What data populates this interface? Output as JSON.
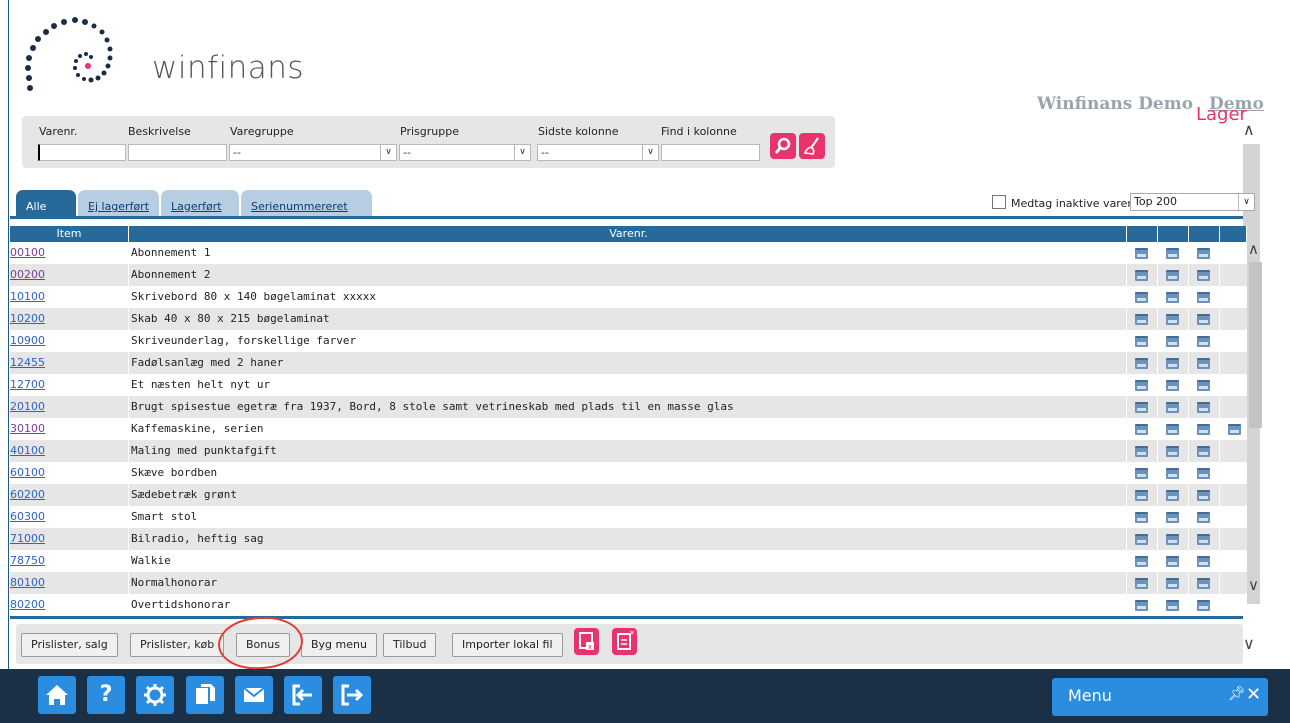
{
  "header": {
    "brand": "winfinans",
    "company": "Winfinans Demo",
    "company_link": "Demo",
    "page_title": "Lager"
  },
  "filters": {
    "labels": [
      "Varenr.",
      "Beskrivelse",
      "Varegruppe",
      "Prisgruppe",
      "Sidste kolonne",
      "Find i kolonne"
    ],
    "varegruppe_value": "--",
    "prisgruppe_value": "--",
    "sidste_kolonne_value": "--"
  },
  "tabs": [
    "Alle",
    "Ej lagerført",
    "Lagerført",
    "Serienummereret"
  ],
  "active_tab": 0,
  "options": {
    "inactive_label": "Medtag inaktive varer",
    "top_select": "Top 200"
  },
  "table": {
    "columns": [
      "Item",
      "Varenr."
    ],
    "rows": [
      {
        "item": "00100",
        "desc": "Abonnement 1",
        "visited": true,
        "docs": 3
      },
      {
        "item": "00200",
        "desc": "Abonnement 2",
        "visited": true,
        "docs": 3
      },
      {
        "item": "10100",
        "desc": "Skrivebord 80 x 140 bøgelaminat xxxxx",
        "visited": false,
        "docs": 3
      },
      {
        "item": "10200",
        "desc": "Skab 40 x 80 x 215 bøgelaminat",
        "visited": false,
        "docs": 3
      },
      {
        "item": "10900",
        "desc": "Skriveunderlag, forskellige farver",
        "visited": false,
        "docs": 3
      },
      {
        "item": "12455",
        "desc": "Fadølsanlæg med 2 haner",
        "visited": false,
        "docs": 3
      },
      {
        "item": "12700",
        "desc": "Et næsten helt nyt ur",
        "visited": false,
        "docs": 3
      },
      {
        "item": "20100",
        "desc": "Brugt spisestue egetræ fra 1937, Bord, 8 stole samt vetrineskab med plads til en masse glas",
        "visited": false,
        "docs": 3
      },
      {
        "item": "30100",
        "desc": "Kaffemaskine, serien",
        "visited": true,
        "docs": 4
      },
      {
        "item": "40100",
        "desc": "Maling med punktafgift",
        "visited": false,
        "docs": 3
      },
      {
        "item": "60100",
        "desc": "Skæve bordben",
        "visited": false,
        "docs": 3
      },
      {
        "item": "60200",
        "desc": "Sædebetræk grønt",
        "visited": false,
        "docs": 3
      },
      {
        "item": "60300",
        "desc": "Smart stol",
        "visited": false,
        "docs": 3
      },
      {
        "item": "71000",
        "desc": "Bilradio, heftig sag",
        "visited": false,
        "docs": 3
      },
      {
        "item": "78750",
        "desc": "Walkie",
        "visited": false,
        "docs": 3
      },
      {
        "item": "80100",
        "desc": "Normalhonorar",
        "visited": false,
        "docs": 3
      },
      {
        "item": "80200",
        "desc": "Overtidshonorar",
        "visited": false,
        "docs": 3
      }
    ]
  },
  "buttons": [
    "Prislister, salg",
    "Prislister, køb",
    "Bonus",
    "Byg menu",
    "Tilbud",
    "Importer lokal fil"
  ],
  "nav": {
    "icons": [
      "home-icon",
      "help-icon",
      "settings-icon",
      "copy-icon",
      "mail-icon",
      "login-icon",
      "logout-icon"
    ],
    "menu_label": "Menu"
  },
  "colors": {
    "accent": "#e8336d",
    "header_blue": "#266a9c",
    "nav_bg": "#1a3047",
    "nav_button": "#2a8de0"
  }
}
